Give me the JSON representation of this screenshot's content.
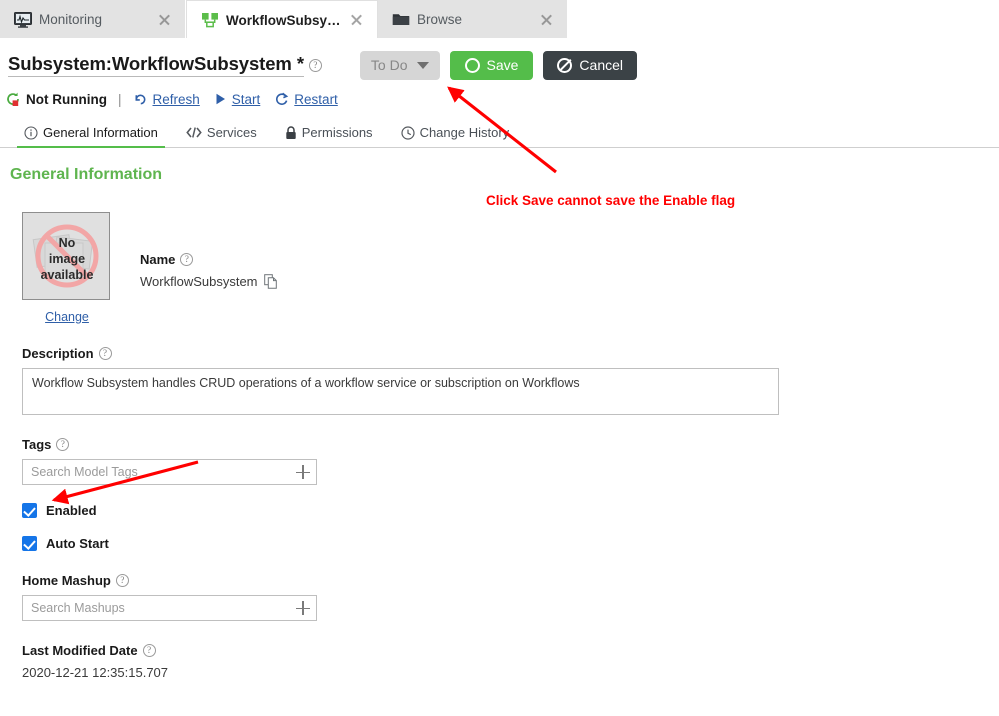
{
  "browser_tabs": [
    {
      "label": "Monitoring",
      "icon": "monitor-icon",
      "active": false
    },
    {
      "label": "WorkflowSubsystem *",
      "icon": "subsystem-icon",
      "active": true
    },
    {
      "label": "Browse",
      "icon": "folder-icon",
      "active": false
    }
  ],
  "header": {
    "title": "Subsystem:WorkflowSubsystem *",
    "help_icon": "help-circle-icon",
    "todo_label": "To Do",
    "todo_icon": "chevron-down-icon",
    "save_label": "Save",
    "save_icon": "circle-icon",
    "cancel_label": "Cancel",
    "cancel_icon": "no-entry-icon",
    "save_color": "#54bd4a",
    "cancel_color": "#3b4246"
  },
  "status": {
    "state_icon": "stopped-status-icon",
    "state_label": "Not Running",
    "separator": "|",
    "actions": [
      {
        "label": "Refresh",
        "icon": "refresh-icon"
      },
      {
        "label": "Start",
        "icon": "play-icon"
      },
      {
        "label": "Restart",
        "icon": "restart-icon"
      }
    ]
  },
  "nav_tabs": [
    {
      "label": "General Information",
      "icon": "info-icon",
      "active": true
    },
    {
      "label": "Services",
      "icon": "code-icon",
      "active": false
    },
    {
      "label": "Permissions",
      "icon": "lock-icon",
      "active": false
    },
    {
      "label": "Change History",
      "icon": "clock-icon",
      "active": false
    }
  ],
  "content": {
    "section_title": "General Information",
    "image": {
      "placeholder_line1": "No",
      "placeholder_line2": "image",
      "placeholder_line3": "available",
      "change_label": "Change"
    },
    "name": {
      "label": "Name",
      "value": "WorkflowSubsystem",
      "copy_icon": "copy-icon"
    },
    "description": {
      "label": "Description",
      "value": "Workflow Subsystem handles CRUD operations of a workflow service or subscription on Workflows"
    },
    "tags": {
      "label": "Tags",
      "placeholder": "Search Model Tags",
      "add_icon": "plus-icon"
    },
    "enabled": {
      "label": "Enabled",
      "checked": true
    },
    "auto_start": {
      "label": "Auto Start",
      "checked": true
    },
    "home_mashup": {
      "label": "Home Mashup",
      "placeholder": "Search Mashups",
      "add_icon": "plus-icon"
    },
    "last_modified": {
      "label": "Last Modified Date",
      "value": "2020-12-21 12:35:15.707"
    }
  },
  "annotations": {
    "note": "Click Save cannot save the Enable flag",
    "color": "#ff0000"
  }
}
